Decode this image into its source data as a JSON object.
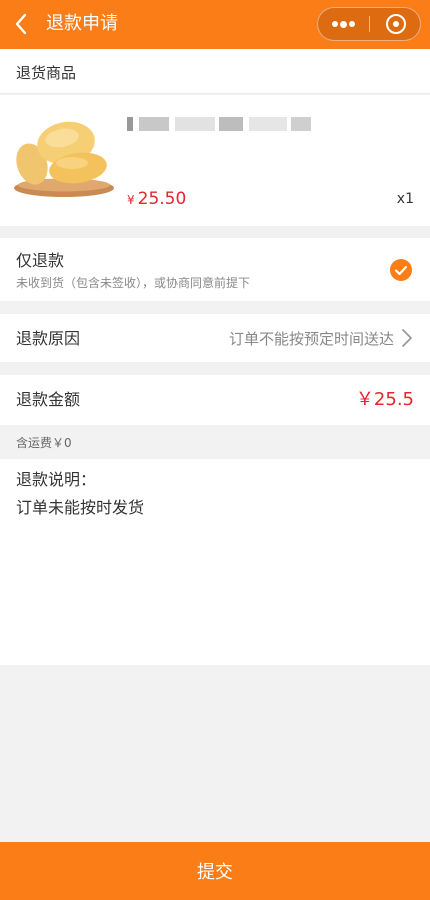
{
  "header": {
    "title": "退款申请",
    "back_icon": "chevron-left-icon",
    "more_icon": "more-dots-icon",
    "close_icon": "target-close-icon",
    "background": "#fa7d18"
  },
  "goods_section": {
    "title": "退货商品",
    "item": {
      "name_obscured": true,
      "image": "mango-on-plate",
      "currency": "¥",
      "price": "25.50",
      "quantity": "x1"
    }
  },
  "refund_type": {
    "title": "仅退款",
    "subtitle": "未收到货（包含未签收），或协商同意前提下",
    "selected": true,
    "check_icon": "check-circle-icon"
  },
  "reason": {
    "label": "退款原因",
    "value": "订单不能按预定时间送达",
    "arrow_icon": "chevron-right-icon"
  },
  "amount": {
    "label": "退款金额",
    "value": "￥25.5"
  },
  "shipping_note": "含运费￥0",
  "description": {
    "label": "退款说明：",
    "text": "订单未能按时发货"
  },
  "submit_button": {
    "label": "提交"
  },
  "colors": {
    "accent": "#fa7d18",
    "price": "#e8242c",
    "page_bg": "#f2f2f2"
  }
}
